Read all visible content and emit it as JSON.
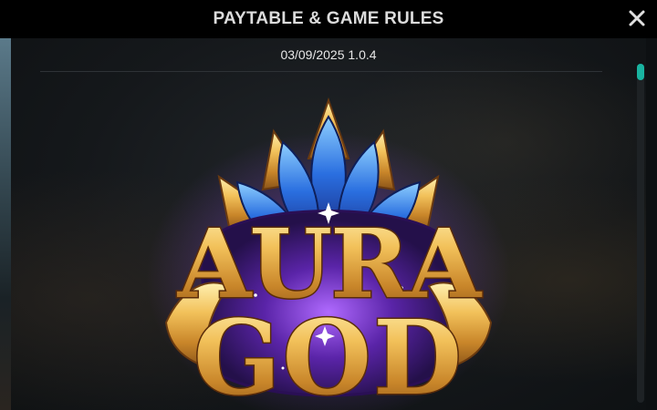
{
  "header": {
    "title": "PAYTABLE & GAME RULES",
    "close_icon": "close-icon"
  },
  "content": {
    "version_text": "03/09/2025 1.0.4",
    "logo": {
      "icon": "game-logo",
      "line1": "AURA",
      "line2": "GOD"
    }
  },
  "colors": {
    "header_bg": "#000000",
    "title_text": "#dcdcdc",
    "scroll_thumb": "#19b3a0",
    "logo_gold": "#e8b54a",
    "logo_blue": "#2a6fe0",
    "logo_purple": "#6a2fb0"
  }
}
